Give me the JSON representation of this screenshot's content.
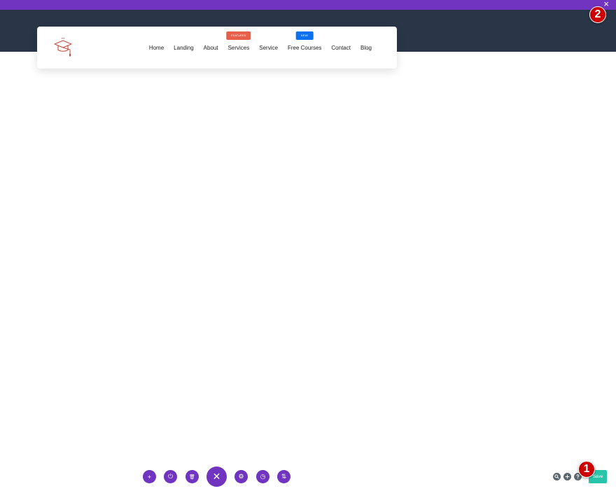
{
  "window": {
    "close_glyph": "×"
  },
  "nav": {
    "items": [
      {
        "label": "Home"
      },
      {
        "label": "Landing"
      },
      {
        "label": "About"
      },
      {
        "label": "Services",
        "badge": "FEATURED"
      },
      {
        "label": "Service"
      },
      {
        "label": "Free Courses",
        "badge": "NEW!"
      },
      {
        "label": "Contact"
      },
      {
        "label": "Blog"
      }
    ]
  },
  "markers": {
    "one": "1",
    "two": "2"
  },
  "toolbar": {
    "add_glyph": "+",
    "power_glyph": "⏻",
    "trash_glyph": "🗑",
    "close_glyph": "✕",
    "settings_glyph": "⚙",
    "history_glyph": "◷",
    "sort_glyph": "⇅",
    "save_label": "Save"
  },
  "colors": {
    "brand_purple": "#7134c0",
    "hero_bg": "#2a3647",
    "featured_badge": "#e8604c",
    "new_badge": "#0c71ef",
    "save_green": "#29c4a9",
    "marker_red": "#cc0000"
  }
}
